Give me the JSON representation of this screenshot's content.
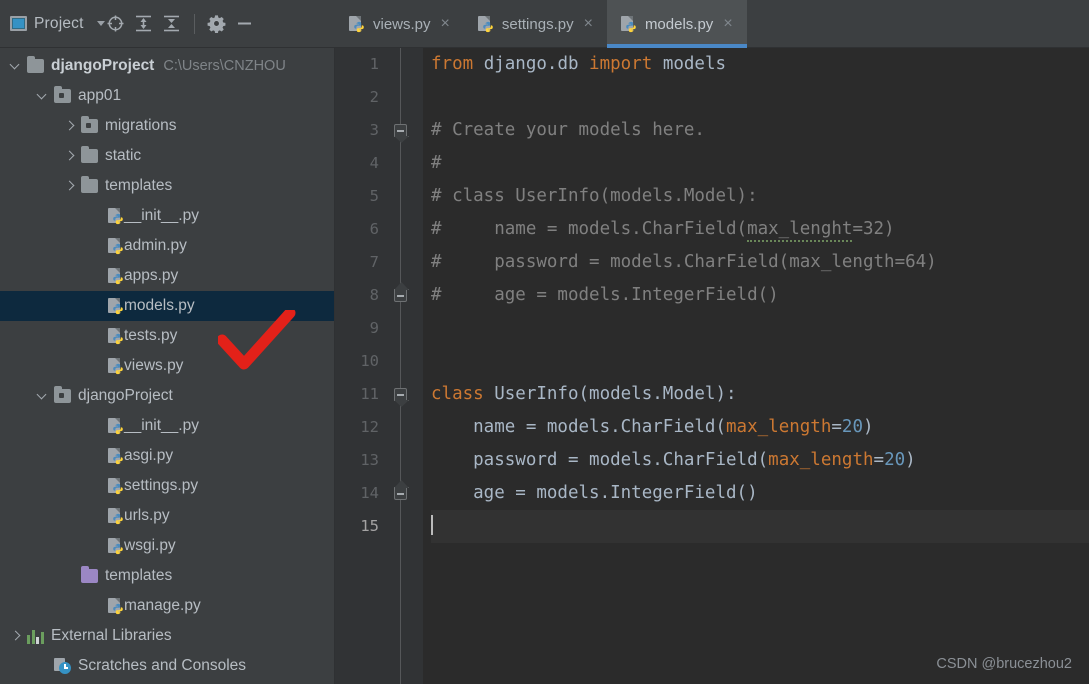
{
  "toolbar": {
    "project_label": "Project",
    "window_icon": "project-window-icon",
    "dropdown_icon": "chevron-down-icon",
    "buttons": [
      {
        "name": "select-opened-file-button",
        "icon": "crosshair-target-icon",
        "label": ""
      },
      {
        "name": "expand-all-button",
        "icon": "expand-all-icon",
        "label": ""
      },
      {
        "name": "collapse-all-button",
        "icon": "collapse-all-icon",
        "label": ""
      },
      {
        "name": "settings-button",
        "icon": "gear-icon",
        "label": ""
      },
      {
        "name": "hide-button",
        "icon": "minus-icon",
        "label": ""
      }
    ]
  },
  "tabs": [
    {
      "label": "views.py",
      "icon": "python-file-icon",
      "active": false,
      "close_icon": "×"
    },
    {
      "label": "settings.py",
      "icon": "python-file-icon",
      "active": false,
      "close_icon": "×"
    },
    {
      "label": "models.py",
      "icon": "python-file-icon",
      "active": true,
      "close_icon": "×"
    }
  ],
  "tree": [
    {
      "label": "djangoProject",
      "path": "C:\\Users\\CNZHOU",
      "icon": "folder-icon",
      "arrow": "open",
      "indent": 0,
      "bold": true,
      "selected": false
    },
    {
      "label": "app01",
      "path": "",
      "icon": "source-folder-icon",
      "arrow": "open",
      "indent": 1,
      "bold": false,
      "selected": false
    },
    {
      "label": "migrations",
      "path": "",
      "icon": "source-folder-icon",
      "arrow": "closed",
      "indent": 2,
      "bold": false,
      "selected": false
    },
    {
      "label": "static",
      "path": "",
      "icon": "folder-icon",
      "arrow": "closed",
      "indent": 2,
      "bold": false,
      "selected": false
    },
    {
      "label": "templates",
      "path": "",
      "icon": "folder-icon",
      "arrow": "closed",
      "indent": 2,
      "bold": false,
      "selected": false
    },
    {
      "label": "__init__.py",
      "path": "",
      "icon": "python-file-icon",
      "arrow": "none",
      "indent": 3,
      "bold": false,
      "selected": false
    },
    {
      "label": "admin.py",
      "path": "",
      "icon": "python-file-icon",
      "arrow": "none",
      "indent": 3,
      "bold": false,
      "selected": false
    },
    {
      "label": "apps.py",
      "path": "",
      "icon": "python-file-icon",
      "arrow": "none",
      "indent": 3,
      "bold": false,
      "selected": false
    },
    {
      "label": "models.py",
      "path": "",
      "icon": "python-file-icon",
      "arrow": "none",
      "indent": 3,
      "bold": false,
      "selected": true
    },
    {
      "label": "tests.py",
      "path": "",
      "icon": "python-file-icon",
      "arrow": "none",
      "indent": 3,
      "bold": false,
      "selected": false
    },
    {
      "label": "views.py",
      "path": "",
      "icon": "python-file-icon",
      "arrow": "none",
      "indent": 3,
      "bold": false,
      "selected": false
    },
    {
      "label": "djangoProject",
      "path": "",
      "icon": "source-folder-icon",
      "arrow": "open",
      "indent": 1,
      "bold": false,
      "selected": false
    },
    {
      "label": "__init__.py",
      "path": "",
      "icon": "python-file-icon",
      "arrow": "none",
      "indent": 3,
      "bold": false,
      "selected": false
    },
    {
      "label": "asgi.py",
      "path": "",
      "icon": "python-file-icon",
      "arrow": "none",
      "indent": 3,
      "bold": false,
      "selected": false
    },
    {
      "label": "settings.py",
      "path": "",
      "icon": "python-file-icon",
      "arrow": "none",
      "indent": 3,
      "bold": false,
      "selected": false
    },
    {
      "label": "urls.py",
      "path": "",
      "icon": "python-file-icon",
      "arrow": "none",
      "indent": 3,
      "bold": false,
      "selected": false
    },
    {
      "label": "wsgi.py",
      "path": "",
      "icon": "python-file-icon",
      "arrow": "none",
      "indent": 3,
      "bold": false,
      "selected": false
    },
    {
      "label": "templates",
      "path": "",
      "icon": "template-folder-icon",
      "arrow": "none",
      "indent": 2,
      "bold": false,
      "selected": false
    },
    {
      "label": "manage.py",
      "path": "",
      "icon": "python-file-icon",
      "arrow": "none",
      "indent": 3,
      "bold": false,
      "selected": false
    },
    {
      "label": "External Libraries",
      "path": "",
      "icon": "external-libraries-icon",
      "arrow": "closed",
      "indent": 0,
      "bold": false,
      "selected": false
    },
    {
      "label": "Scratches and Consoles",
      "path": "",
      "icon": "scratches-icon",
      "arrow": "none",
      "indent": 1,
      "bold": false,
      "selected": false
    }
  ],
  "annotation": {
    "checkmark_color": "#e32119",
    "name": "red-checkmark-annotation"
  },
  "editor": {
    "line_numbers": [
      "1",
      "2",
      "3",
      "4",
      "5",
      "6",
      "7",
      "8",
      "9",
      "10",
      "11",
      "12",
      "13",
      "14",
      "15"
    ],
    "current_line": 15,
    "lines": [
      {
        "n": 1,
        "segments": [
          {
            "t": "from ",
            "c": "kw"
          },
          {
            "t": "django.db ",
            "c": ""
          },
          {
            "t": "import ",
            "c": "kw"
          },
          {
            "t": "models",
            "c": ""
          }
        ]
      },
      {
        "n": 2,
        "segments": []
      },
      {
        "n": 3,
        "segments": [
          {
            "t": "# Create your models here.",
            "c": "cm"
          }
        ]
      },
      {
        "n": 4,
        "segments": [
          {
            "t": "#",
            "c": "cm"
          }
        ]
      },
      {
        "n": 5,
        "segments": [
          {
            "t": "# class UserInfo(models.Model):",
            "c": "cm"
          }
        ]
      },
      {
        "n": 6,
        "segments": [
          {
            "t": "#     name = models.CharField(",
            "c": "cm"
          },
          {
            "t": "max_lenght",
            "c": "cm typo"
          },
          {
            "t": "=32)",
            "c": "cm"
          }
        ]
      },
      {
        "n": 7,
        "segments": [
          {
            "t": "#     password = models.CharField(max_length=64)",
            "c": "cm"
          }
        ]
      },
      {
        "n": 8,
        "segments": [
          {
            "t": "#     age = models.IntegerField()",
            "c": "cm"
          }
        ]
      },
      {
        "n": 9,
        "segments": []
      },
      {
        "n": 10,
        "segments": []
      },
      {
        "n": 11,
        "segments": [
          {
            "t": "class ",
            "c": "kw"
          },
          {
            "t": "UserInfo(models.Model):",
            "c": ""
          }
        ]
      },
      {
        "n": 12,
        "segments": [
          {
            "t": "    name = models.CharField(",
            "c": ""
          },
          {
            "t": "max_length",
            "c": "kwarg"
          },
          {
            "t": "=",
            "c": ""
          },
          {
            "t": "20",
            "c": "num"
          },
          {
            "t": ")",
            "c": ""
          }
        ]
      },
      {
        "n": 13,
        "segments": [
          {
            "t": "    password = models.CharField(",
            "c": ""
          },
          {
            "t": "max_length",
            "c": "kwarg"
          },
          {
            "t": "=",
            "c": ""
          },
          {
            "t": "20",
            "c": "num"
          },
          {
            "t": ")",
            "c": ""
          }
        ]
      },
      {
        "n": 14,
        "segments": [
          {
            "t": "    age = models.IntegerField()",
            "c": ""
          }
        ]
      },
      {
        "n": 15,
        "segments": []
      }
    ],
    "fold_markers": [
      {
        "line": 3,
        "type": "top"
      },
      {
        "line": 8,
        "type": "bot"
      },
      {
        "line": 11,
        "type": "top"
      },
      {
        "line": 14,
        "type": "bot"
      }
    ]
  },
  "watermark": "CSDN @brucezhou2",
  "colors": {
    "editor_bg": "#2b2b2b",
    "gutter_bg": "#313335",
    "panel_bg": "#3c3f41",
    "selection_bg": "#0d293e",
    "active_tab_bg": "#4e5254",
    "accent_blue": "#4a88c7",
    "keyword_orange": "#cc7832",
    "number_blue": "#6897bb",
    "comment_gray": "#808080",
    "text": "#a9b7c6"
  }
}
